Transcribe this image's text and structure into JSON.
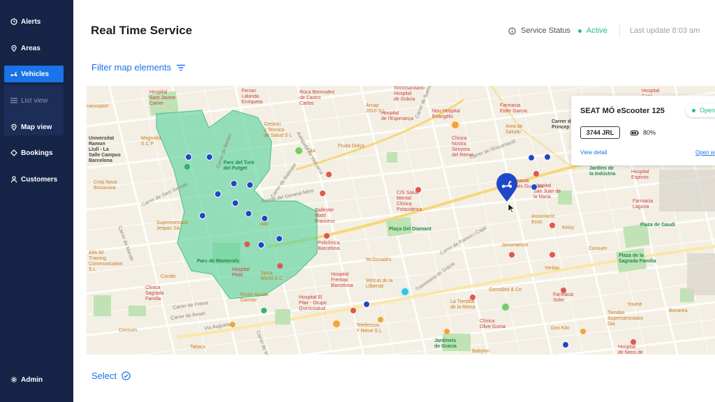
{
  "sidebar": {
    "items": [
      {
        "label": "Alerts",
        "icon": "clock-icon"
      },
      {
        "label": "Areas",
        "icon": "pin-icon"
      },
      {
        "label": "Vehicles",
        "icon": "scooter-icon"
      },
      {
        "label": "Bookings",
        "icon": "diamond-icon"
      },
      {
        "label": "Customers",
        "icon": "person-icon"
      }
    ],
    "sub_items": [
      {
        "label": "List view",
        "icon": "list-icon"
      },
      {
        "label": "Map view",
        "icon": "pin-icon"
      }
    ],
    "admin": {
      "label": "Admin",
      "icon": "gear-icon"
    }
  },
  "header": {
    "title": "Real Time Service",
    "service_status_label": "Service Status",
    "service_status_value": "Active",
    "last_update": "Last update 8:03 am"
  },
  "filter": {
    "label": "Filter map elements"
  },
  "map": {
    "streets": [
      "Carrer de Balmes",
      "Ronda del General Mitre",
      "Carrer de Mandri",
      "Carrer de Freixa",
      "Carrer de Reset",
      "Via Augusta",
      "Travessera de Gràcia",
      "Carrer de Muntaner",
      "Carrer de Ballester",
      "Carrer de l'Encarnació",
      "Carrer de Ramon i Cajal",
      "Carrer de Sant Gervasi",
      "Avinguda de Vallcarca",
      "Carrer de Bertan"
    ],
    "pois": [
      {
        "text": "Hospital\nSant Jaume\nCarrer",
        "color": "red"
      },
      {
        "text": "Ferran\nLalanda\nEnriqueta",
        "color": "red"
      },
      {
        "text": "Roca Bermudez\nde Castro\nCarlos",
        "color": "red"
      },
      {
        "text": "Arcap\n2010 S L",
        "color": "orange"
      },
      {
        "text": "Sociosanitario\nHospital\nde Gràcia",
        "color": "red"
      },
      {
        "text": "Hospital\nde l'Esperança",
        "color": "red"
      },
      {
        "text": "Nou Hospital\nEvangèlic",
        "color": "red"
      },
      {
        "text": "Clínica\nNostra\nSenyora\ndel Remei",
        "color": "red"
      },
      {
        "text": "Farmacia\nEider Garcia",
        "color": "red"
      },
      {
        "text": "Area de\nSaludo",
        "color": "orange"
      },
      {
        "text": "Universitat\nRamon\nLlull - La\nSalle Campus\nBarcelona",
        "color": "dark"
      },
      {
        "text": "Magnolia\nS C P",
        "color": "orange"
      },
      {
        "text": "Gestion\ny Tecnica\nde Salud S L",
        "color": "orange"
      },
      {
        "text": "Parc del Turó\ndel Putget",
        "color": "green"
      },
      {
        "text": "Dia",
        "color": "orange"
      },
      {
        "text": "Fruita Dolça",
        "color": "orange"
      },
      {
        "text": "Crep Nova\nBonanova",
        "color": "orange"
      },
      {
        "text": "Supermercado\nJespac SA",
        "color": "orange"
      },
      {
        "text": "Albi",
        "color": "orange"
      },
      {
        "text": "Ballester\nMartí\nFrancesc",
        "color": "red"
      },
      {
        "text": "CIS Salud\nMental\nClínica\nPsiquiátrica",
        "color": "red"
      },
      {
        "text": "Plaça Del Diamant",
        "color": "green"
      },
      {
        "text": "Jardins de\nla Indústria",
        "color": "green"
      },
      {
        "text": "Associació\nEcos",
        "color": "orange"
      },
      {
        "text": "Keisy",
        "color": "orange"
      },
      {
        "text": "Plaza de Gaudí",
        "color": "green"
      },
      {
        "text": "Farmacia\nLaguna",
        "color": "red"
      },
      {
        "text": "Hospital\nEspinos",
        "color": "red"
      },
      {
        "text": "Parc de Monterols",
        "color": "green"
      },
      {
        "text": "Policlínica\nBarcelona",
        "color": "red"
      },
      {
        "text": "McDonald's",
        "color": "orange"
      },
      {
        "text": "Jamonarium",
        "color": "orange"
      },
      {
        "text": "Consum",
        "color": "orange"
      },
      {
        "text": "Plaza de la\nSagrada Familia",
        "color": "green"
      },
      {
        "text": "Veritas",
        "color": "orange"
      },
      {
        "text": "Hospital\nPlató",
        "color": "red"
      },
      {
        "text": "Spica\nWorld S C",
        "color": "orange"
      },
      {
        "text": "Hospital\nFremap\nBarcelona",
        "color": "red"
      },
      {
        "text": "Mercat de la\nLlibertat",
        "color": "orange"
      },
      {
        "text": "González & Ce",
        "color": "orange"
      },
      {
        "text": "Farmàcia\nSoler",
        "color": "red"
      },
      {
        "text": "Alfa 60\nTraining\nCommunication\nS L",
        "color": "orange"
      },
      {
        "text": "Condis",
        "color": "orange"
      },
      {
        "text": "Clínica\nSagrada\nFamilia",
        "color": "red"
      },
      {
        "text": "Roser Ayuda\nGarrote",
        "color": "orange"
      },
      {
        "text": "Hospital El\nPilar - Grupo\nQuirónsalud",
        "color": "red"
      },
      {
        "text": "La Tiendita\nde la Reina",
        "color": "orange"
      },
      {
        "text": "Youme",
        "color": "orange"
      },
      {
        "text": "Tiendas\nSupercarocados\nDia",
        "color": "orange"
      },
      {
        "text": "Bonarea",
        "color": "orange"
      },
      {
        "text": "Consum",
        "color": "orange"
      },
      {
        "text": "Telefericos\nY Nieve S L",
        "color": "orange"
      },
      {
        "text": "Clínica\nOlive Guma",
        "color": "red"
      },
      {
        "text": "Don Kilo",
        "color": "orange"
      },
      {
        "text": "Tabacs",
        "color": "orange"
      },
      {
        "text": "Jardinets\nde Gràcia",
        "color": "green"
      },
      {
        "text": "Babylon",
        "color": "orange"
      },
      {
        "text": "Hospital\nde Nens de",
        "color": "red"
      },
      {
        "text": "Hospital\nSant\nFreixe",
        "color": "red"
      },
      {
        "text": "Farmacia\nValdés Guzmán",
        "color": "red"
      },
      {
        "text": "Hospital\nSan Juan de\nla Maria",
        "color": "red"
      },
      {
        "text": "Carrer de\nPrincep",
        "color": "dark"
      },
      {
        "text": "nanosport",
        "color": "orange"
      }
    ]
  },
  "card": {
    "title": "SEAT MÓ eScooter 125",
    "status": "Open",
    "plate": "3744 JRL",
    "battery": "80%",
    "view_detail": "View detail",
    "open_window": "Open w"
  },
  "footer": {
    "select_label": "Select"
  },
  "colors": {
    "sidebar": "#152447",
    "accent": "#1a73e8",
    "active": "#28b98a",
    "area": "#5fd3a0"
  }
}
